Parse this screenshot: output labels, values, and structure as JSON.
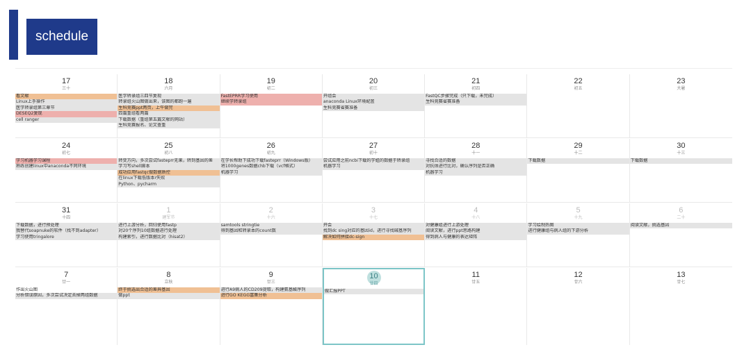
{
  "header": {
    "title": "schedule"
  },
  "colors": {
    "brand": "#1f3a8a",
    "event_gray": "#e4e4e4",
    "event_orange": "#f0c094",
    "event_pink": "#eeb0ad",
    "today_ring": "#7cc5c7"
  },
  "weeks": [
    {
      "days": [
        {
          "num": "17",
          "lunar": "三十",
          "events": [
            {
              "text": "看文献",
              "c": "o"
            },
            {
              "text": "Linux上手操作",
              "c": "g"
            },
            {
              "text": "医学转录组第三章节",
              "c": "g"
            },
            {
              "text": "DESEQ2复现",
              "c": "p"
            },
            {
              "text": "cell ranger",
              "c": "g"
            }
          ]
        },
        {
          "num": "18",
          "lunar": "六月",
          "events": [
            {
              "text": "医学转录组三四节复现",
              "c": "g"
            },
            {
              "text": "转录组火山图做出来，该图的都跑一遍",
              "c": "g"
            },
            {
              "text": "生科竞赛ppt两页，上午做完",
              "c": "o"
            },
            {
              "text": "四篇重组看两篇",
              "c": "g"
            },
            {
              "text": "下载数据（重组第五篇文献的网站）",
              "c": "g"
            },
            {
              "text": "生科竞赛报名、论文查重",
              "c": "g"
            }
          ]
        },
        {
          "num": "19",
          "lunar": "初二",
          "events": [
            {
              "text": "FastEPRR学习使用",
              "c": "p"
            },
            {
              "text": "继续学转录组",
              "c": "p"
            }
          ]
        },
        {
          "num": "20",
          "lunar": "初三",
          "events": [
            {
              "text": "开组会",
              "c": "g"
            },
            {
              "text": "anaconda Linux环境配置",
              "c": "g"
            },
            {
              "text": "生科竞赛省赛准备",
              "c": "g"
            }
          ]
        },
        {
          "num": "21",
          "lunar": "初四",
          "events": [
            {
              "text": "FastQC步骤完成（只下载，未完成）",
              "c": "g"
            },
            {
              "text": "生科竞赛省赛准备",
              "c": "g"
            }
          ]
        },
        {
          "num": "22",
          "lunar": "初五",
          "events": []
        },
        {
          "num": "23",
          "lunar": "大暑",
          "events": []
        }
      ]
    },
    {
      "days": [
        {
          "num": "24",
          "lunar": "初七",
          "events": [
            {
              "text": "学习机器学习课程",
              "c": "p"
            },
            {
              "text": "熟练创建linux中anaconda不同环境",
              "c": "g"
            }
          ]
        },
        {
          "num": "25",
          "lunar": "初八",
          "events": [
            {
              "text": "转变方向，多次尝试fasteprr无果，转到基因的差",
              "c": "g"
            },
            {
              "text": "学习写shell脚本",
              "c": "g"
            },
            {
              "text": "成功应用fastqc做数据质控",
              "c": "o"
            },
            {
              "text": "在linux下载低版本r失败",
              "c": "g"
            },
            {
              "text": "Python、pycharm",
              "c": "g"
            }
          ]
        },
        {
          "num": "26",
          "lunar": "初九",
          "events": [
            {
              "text": "在学长帮助下成功下载fasteprr（Windows版）",
              "c": "g"
            },
            {
              "text": "将1000genes数据chb下载（vcf格式）",
              "c": "g"
            },
            {
              "text": "机器学习",
              "c": "g"
            }
          ]
        },
        {
          "num": "27",
          "lunar": "初十",
          "events": [
            {
              "text": "尝试应用之前ncbi下载的学姐的数据于转录组",
              "c": "g"
            },
            {
              "text": "机器学习",
              "c": "g"
            }
          ]
        },
        {
          "num": "28",
          "lunar": "十一",
          "events": [
            {
              "text": "寻找合适的数据",
              "c": "g"
            },
            {
              "text": "对抗体进行比对，确认序列是否正确",
              "c": "g"
            },
            {
              "text": "机器学习",
              "c": "g"
            }
          ]
        },
        {
          "num": "29",
          "lunar": "十二",
          "events": [
            {
              "text": "下载数据",
              "c": "g"
            }
          ]
        },
        {
          "num": "30",
          "lunar": "十三",
          "events": [
            {
              "text": "下载数据",
              "c": "g"
            }
          ]
        }
      ]
    },
    {
      "days": [
        {
          "num": "31",
          "lunar": "十四",
          "events": [
            {
              "text": "下载数据，进行预处理",
              "c": "g"
            },
            {
              "text": "我替代soapnuke的软件（找不到adapter）",
              "c": "g"
            },
            {
              "text": "学习使用tringalore",
              "c": "g"
            }
          ]
        },
        {
          "num": "1",
          "lunar": "建军节",
          "muted": true,
          "events": [
            {
              "text": "进行上游分析，回归使用fastp",
              "c": "g"
            },
            {
              "text": "对20个序列10组数据进行处理",
              "c": "g"
            },
            {
              "text": "构建索引，进行数据比对（hisat2）",
              "c": "g"
            }
          ]
        },
        {
          "num": "2",
          "lunar": "十六",
          "muted": true,
          "events": [
            {
              "text": "samtools stringtie",
              "c": "g"
            },
            {
              "text": "得到基因和转录本的count数",
              "c": "g"
            }
          ]
        },
        {
          "num": "3",
          "lunar": "十七",
          "muted": true,
          "events": [
            {
              "text": "开会",
              "c": "g"
            },
            {
              "text": "找到dc sing对应的基因id，进行寻找碱基序列",
              "c": "g"
            },
            {
              "text": "解决如何拼接dc-sign",
              "c": "o"
            }
          ]
        },
        {
          "num": "4",
          "lunar": "十八",
          "muted": true,
          "events": [
            {
              "text": "对健康组进行上游处理",
              "c": "g"
            },
            {
              "text": "阅读文献，进行ppt思路构建",
              "c": "g"
            },
            {
              "text": "得到病人与健康的表达矩阵",
              "c": "g"
            }
          ]
        },
        {
          "num": "5",
          "lunar": "十九",
          "muted": true,
          "events": [
            {
              "text": "学习绘制热图",
              "c": "g"
            },
            {
              "text": "进行健康组与病人组的下游分析",
              "c": "g"
            }
          ]
        },
        {
          "num": "6",
          "lunar": "二十",
          "muted": true,
          "events": [
            {
              "text": "阅读文献，挑选基因",
              "c": "g"
            }
          ]
        }
      ]
    },
    {
      "days": [
        {
          "num": "7",
          "lunar": "廿一",
          "events": [
            {
              "text": "作出火山图",
              "c": "n"
            },
            {
              "text": "分析错误原因，多次尝试决定去掉两组数据",
              "c": "g"
            }
          ]
        },
        {
          "num": "8",
          "lunar": "立秋",
          "events": [
            {
              "text": "终于挑选出合适的差异基因",
              "c": "o"
            },
            {
              "text": "做ppt",
              "c": "g"
            }
          ]
        },
        {
          "num": "9",
          "lunar": "廿三",
          "events": [
            {
              "text": "进行A9病人的CD209提取，构建氨基酸序列",
              "c": "g"
            },
            {
              "text": "进行GO KEGG富集分析",
              "c": "o"
            }
          ]
        },
        {
          "num": "10",
          "lunar": "廿四",
          "today": true,
          "events": [
            {
              "text": "做汇报PPT",
              "c": "g"
            }
          ]
        },
        {
          "num": "11",
          "lunar": "廿五",
          "events": []
        },
        {
          "num": "12",
          "lunar": "廿六",
          "events": []
        },
        {
          "num": "13",
          "lunar": "廿七",
          "events": []
        }
      ]
    }
  ]
}
